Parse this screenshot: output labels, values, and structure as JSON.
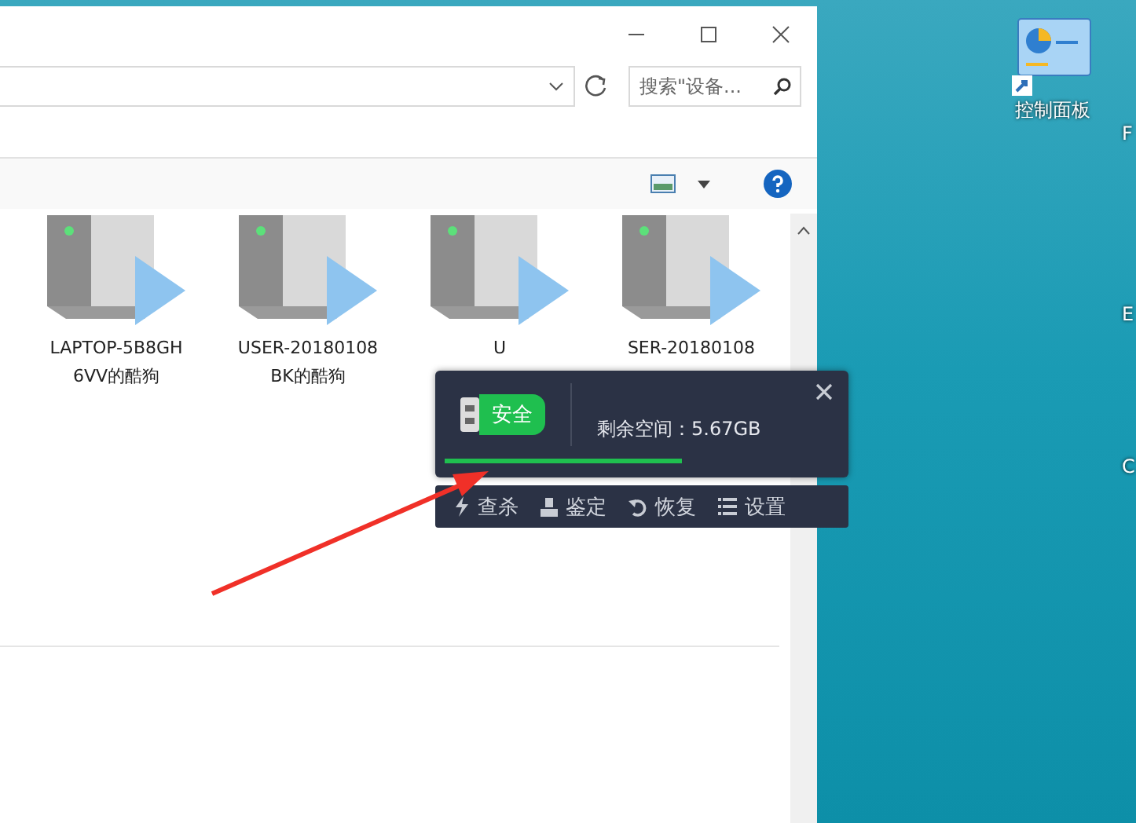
{
  "explorer": {
    "search": {
      "placeholder": "搜索\"设备..."
    },
    "items": [
      {
        "label": "LAPTOP-5B8GH 6VV的酷狗"
      },
      {
        "label": "USER-20180108 BK的酷狗"
      },
      {
        "label": "U"
      },
      {
        "label": "SER-20180108"
      }
    ]
  },
  "usb_popup": {
    "status": "安全",
    "free_space": "剩余空间：5.67GB",
    "level": 0.6,
    "actions": [
      {
        "kind": "bolt",
        "label": "查杀"
      },
      {
        "kind": "stamp",
        "label": "鉴定"
      },
      {
        "kind": "restore",
        "label": "恢复"
      },
      {
        "kind": "list",
        "label": "设置"
      }
    ]
  },
  "desktop": {
    "icons": [
      {
        "label": "控制面板"
      }
    ],
    "edge_labels": [
      "F",
      "E",
      "C"
    ]
  }
}
